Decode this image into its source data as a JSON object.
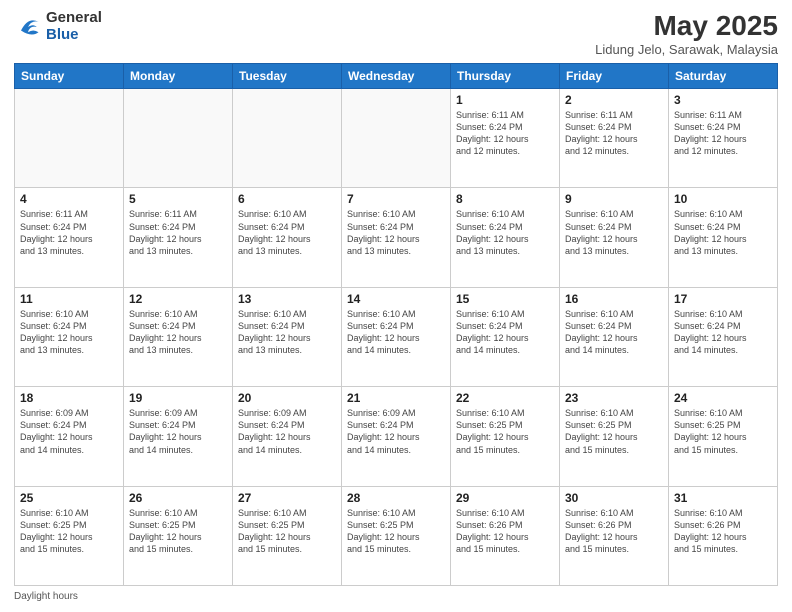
{
  "logo": {
    "general": "General",
    "blue": "Blue"
  },
  "title": "May 2025",
  "subtitle": "Lidung Jelo, Sarawak, Malaysia",
  "days_of_week": [
    "Sunday",
    "Monday",
    "Tuesday",
    "Wednesday",
    "Thursday",
    "Friday",
    "Saturday"
  ],
  "footer_label": "Daylight hours",
  "weeks": [
    [
      {
        "day": "",
        "info": ""
      },
      {
        "day": "",
        "info": ""
      },
      {
        "day": "",
        "info": ""
      },
      {
        "day": "",
        "info": ""
      },
      {
        "day": "1",
        "info": "Sunrise: 6:11 AM\nSunset: 6:24 PM\nDaylight: 12 hours\nand 12 minutes."
      },
      {
        "day": "2",
        "info": "Sunrise: 6:11 AM\nSunset: 6:24 PM\nDaylight: 12 hours\nand 12 minutes."
      },
      {
        "day": "3",
        "info": "Sunrise: 6:11 AM\nSunset: 6:24 PM\nDaylight: 12 hours\nand 12 minutes."
      }
    ],
    [
      {
        "day": "4",
        "info": "Sunrise: 6:11 AM\nSunset: 6:24 PM\nDaylight: 12 hours\nand 13 minutes."
      },
      {
        "day": "5",
        "info": "Sunrise: 6:11 AM\nSunset: 6:24 PM\nDaylight: 12 hours\nand 13 minutes."
      },
      {
        "day": "6",
        "info": "Sunrise: 6:10 AM\nSunset: 6:24 PM\nDaylight: 12 hours\nand 13 minutes."
      },
      {
        "day": "7",
        "info": "Sunrise: 6:10 AM\nSunset: 6:24 PM\nDaylight: 12 hours\nand 13 minutes."
      },
      {
        "day": "8",
        "info": "Sunrise: 6:10 AM\nSunset: 6:24 PM\nDaylight: 12 hours\nand 13 minutes."
      },
      {
        "day": "9",
        "info": "Sunrise: 6:10 AM\nSunset: 6:24 PM\nDaylight: 12 hours\nand 13 minutes."
      },
      {
        "day": "10",
        "info": "Sunrise: 6:10 AM\nSunset: 6:24 PM\nDaylight: 12 hours\nand 13 minutes."
      }
    ],
    [
      {
        "day": "11",
        "info": "Sunrise: 6:10 AM\nSunset: 6:24 PM\nDaylight: 12 hours\nand 13 minutes."
      },
      {
        "day": "12",
        "info": "Sunrise: 6:10 AM\nSunset: 6:24 PM\nDaylight: 12 hours\nand 13 minutes."
      },
      {
        "day": "13",
        "info": "Sunrise: 6:10 AM\nSunset: 6:24 PM\nDaylight: 12 hours\nand 13 minutes."
      },
      {
        "day": "14",
        "info": "Sunrise: 6:10 AM\nSunset: 6:24 PM\nDaylight: 12 hours\nand 14 minutes."
      },
      {
        "day": "15",
        "info": "Sunrise: 6:10 AM\nSunset: 6:24 PM\nDaylight: 12 hours\nand 14 minutes."
      },
      {
        "day": "16",
        "info": "Sunrise: 6:10 AM\nSunset: 6:24 PM\nDaylight: 12 hours\nand 14 minutes."
      },
      {
        "day": "17",
        "info": "Sunrise: 6:10 AM\nSunset: 6:24 PM\nDaylight: 12 hours\nand 14 minutes."
      }
    ],
    [
      {
        "day": "18",
        "info": "Sunrise: 6:09 AM\nSunset: 6:24 PM\nDaylight: 12 hours\nand 14 minutes."
      },
      {
        "day": "19",
        "info": "Sunrise: 6:09 AM\nSunset: 6:24 PM\nDaylight: 12 hours\nand 14 minutes."
      },
      {
        "day": "20",
        "info": "Sunrise: 6:09 AM\nSunset: 6:24 PM\nDaylight: 12 hours\nand 14 minutes."
      },
      {
        "day": "21",
        "info": "Sunrise: 6:09 AM\nSunset: 6:24 PM\nDaylight: 12 hours\nand 14 minutes."
      },
      {
        "day": "22",
        "info": "Sunrise: 6:10 AM\nSunset: 6:25 PM\nDaylight: 12 hours\nand 15 minutes."
      },
      {
        "day": "23",
        "info": "Sunrise: 6:10 AM\nSunset: 6:25 PM\nDaylight: 12 hours\nand 15 minutes."
      },
      {
        "day": "24",
        "info": "Sunrise: 6:10 AM\nSunset: 6:25 PM\nDaylight: 12 hours\nand 15 minutes."
      }
    ],
    [
      {
        "day": "25",
        "info": "Sunrise: 6:10 AM\nSunset: 6:25 PM\nDaylight: 12 hours\nand 15 minutes."
      },
      {
        "day": "26",
        "info": "Sunrise: 6:10 AM\nSunset: 6:25 PM\nDaylight: 12 hours\nand 15 minutes."
      },
      {
        "day": "27",
        "info": "Sunrise: 6:10 AM\nSunset: 6:25 PM\nDaylight: 12 hours\nand 15 minutes."
      },
      {
        "day": "28",
        "info": "Sunrise: 6:10 AM\nSunset: 6:25 PM\nDaylight: 12 hours\nand 15 minutes."
      },
      {
        "day": "29",
        "info": "Sunrise: 6:10 AM\nSunset: 6:26 PM\nDaylight: 12 hours\nand 15 minutes."
      },
      {
        "day": "30",
        "info": "Sunrise: 6:10 AM\nSunset: 6:26 PM\nDaylight: 12 hours\nand 15 minutes."
      },
      {
        "day": "31",
        "info": "Sunrise: 6:10 AM\nSunset: 6:26 PM\nDaylight: 12 hours\nand 15 minutes."
      }
    ]
  ]
}
